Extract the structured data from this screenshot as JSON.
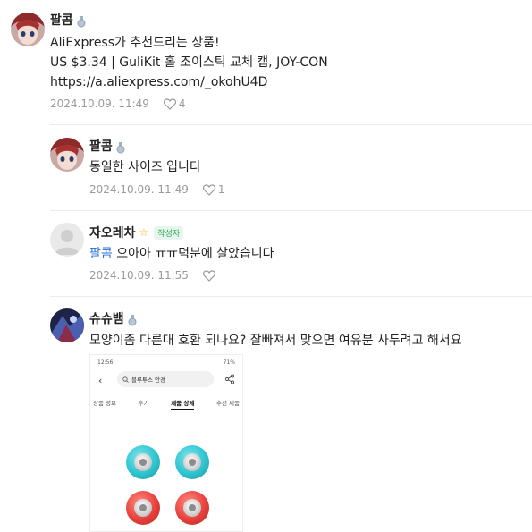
{
  "comments": [
    {
      "user": "팔콤",
      "lines": [
        "AliExpress가 추천드리는 상품!",
        "US $3.34 | GuliKit 홀 조이스틱 교체 캡, JOY-CON",
        "https://a.aliexpress.com/_okohU4D"
      ],
      "date": "2024.10.09. 11:49",
      "likes": "4"
    },
    {
      "user": "팔콤",
      "text": "동일한 사이즈 입니다",
      "date": "2024.10.09. 11:49",
      "likes": "1"
    },
    {
      "user": "자오레차",
      "badge": "작성자",
      "mention": "팔콤",
      "text": " 으아아 ㅠㅠ덕분에 살았습니다",
      "date": "2024.10.09. 11:55",
      "likes": ""
    },
    {
      "user": "슈슈뱀",
      "text": "모양이좀 다른대 호환 되나요? 잘빠져서 맞으면 여유분 사두려고 해서요"
    }
  ],
  "attachment": {
    "status_time": "12:56",
    "status_right": "71%",
    "search_text": "블루투스 안경",
    "tabs": [
      "상품 정보",
      "후기",
      "제품 상세",
      "추천 제품"
    ],
    "active_tab": "제품 상세"
  },
  "colors": {
    "mention": "#2b6fd6",
    "meta": "#9a9a9a",
    "teal_cap": "#2ec4cf",
    "red_cap": "#e8413c"
  }
}
